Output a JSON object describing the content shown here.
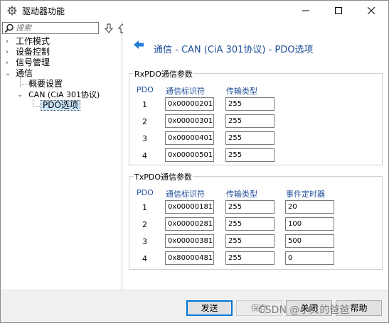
{
  "window": {
    "title": "驱动器功能",
    "icon": "gear-icon",
    "controls": [
      "minimize",
      "maximize",
      "close"
    ]
  },
  "search": {
    "placeholder": "搜索"
  },
  "tree": {
    "items": [
      {
        "label": "工作模式",
        "expanded": false
      },
      {
        "label": "设备控制",
        "expanded": false
      },
      {
        "label": "信号管理",
        "expanded": false
      },
      {
        "label": "通信",
        "expanded": true
      },
      {
        "label": "概要设置"
      },
      {
        "label": "CAN (CiA 301协议)",
        "expanded": true
      },
      {
        "label": "PDO选项",
        "selected": true
      }
    ]
  },
  "header": {
    "title": "通信 - CAN (CiA 301协议) - PDO选项"
  },
  "rxpdo": {
    "title": "RxPDO通信参数",
    "columns": [
      "PDO",
      "通信标识符",
      "传输类型"
    ],
    "rows": [
      {
        "pdo": "1",
        "cob_id": "0x00000201",
        "transmission": "255"
      },
      {
        "pdo": "2",
        "cob_id": "0x00000301",
        "transmission": "255"
      },
      {
        "pdo": "3",
        "cob_id": "0x00000401",
        "transmission": "255"
      },
      {
        "pdo": "4",
        "cob_id": "0x00000501",
        "transmission": "255"
      }
    ]
  },
  "txpdo": {
    "title": "TxPDO通信参数",
    "columns": [
      "PDO",
      "通信标识符",
      "传输类型",
      "事件定时器"
    ],
    "rows": [
      {
        "pdo": "1",
        "cob_id": "0x00000181",
        "transmission": "255",
        "event_timer": "20"
      },
      {
        "pdo": "2",
        "cob_id": "0x00000281",
        "transmission": "255",
        "event_timer": "100"
      },
      {
        "pdo": "3",
        "cob_id": "0x00000381",
        "transmission": "255",
        "event_timer": "500"
      },
      {
        "pdo": "4",
        "cob_id": "0x80000481",
        "transmission": "255",
        "event_timer": "0"
      }
    ]
  },
  "buttons": {
    "send": "发送",
    "save": "保存",
    "close": "关闭",
    "help": "帮助"
  },
  "watermark": "CSDN @小贝的爸爸",
  "colors": {
    "accent": "#1f4e9a",
    "selection": "#cce8ff",
    "primary_border": "#0078d7"
  }
}
